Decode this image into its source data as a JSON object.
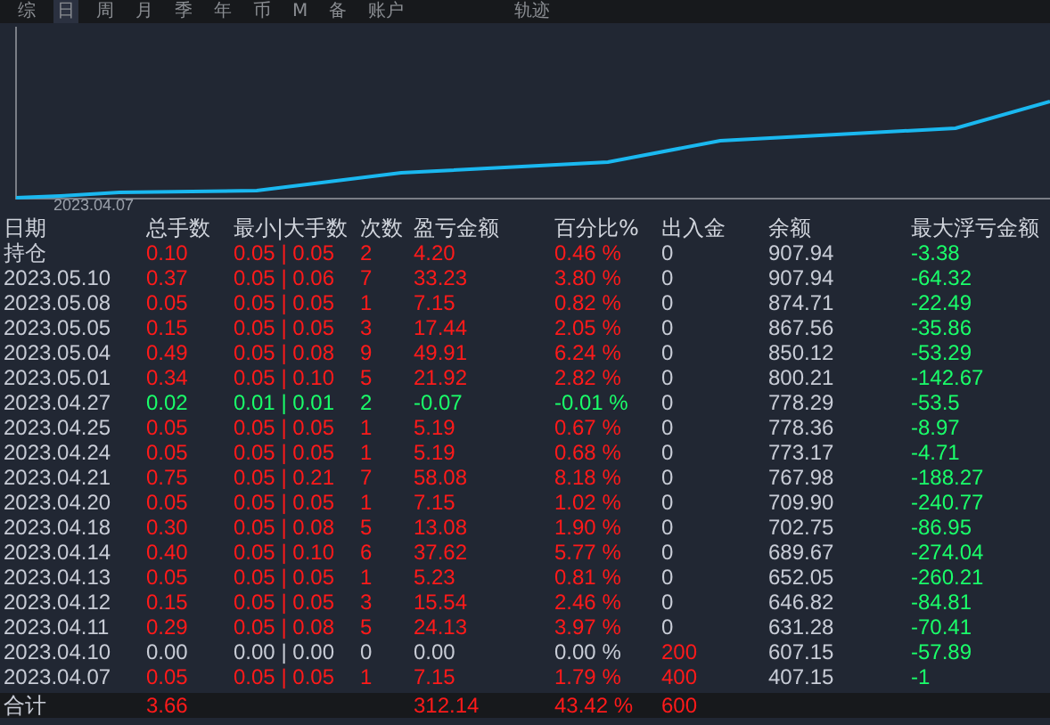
{
  "tabs": [
    {
      "label": "综",
      "selected": false
    },
    {
      "label": "日",
      "selected": true
    },
    {
      "label": "周",
      "selected": false
    },
    {
      "label": "月",
      "selected": false
    },
    {
      "label": "季",
      "selected": false
    },
    {
      "label": "年",
      "selected": false
    },
    {
      "label": "币",
      "selected": false
    },
    {
      "label": "M",
      "selected": false
    },
    {
      "label": "备",
      "selected": false
    },
    {
      "label": "账户",
      "selected": false
    },
    {
      "label": "轨迹",
      "selected": false
    }
  ],
  "chart": {
    "start_label": "2023.04.07"
  },
  "table": {
    "columns": [
      "日期",
      "总手数",
      "最小|大手数",
      "次数",
      "盈亏金额",
      "百分比%",
      "出入金",
      "余额",
      "最大浮亏金额"
    ],
    "rows": [
      {
        "date": "持仓",
        "lots": "0.10",
        "minmax": "0.05 | 0.05",
        "count": "2",
        "pnl": "4.20",
        "pct": "0.46 %",
        "flow": "0",
        "balance": "907.94",
        "max_float": "-3.38",
        "kind": "profit",
        "deposit": false
      },
      {
        "date": "2023.05.10",
        "lots": "0.37",
        "minmax": "0.05 | 0.06",
        "count": "7",
        "pnl": "33.23",
        "pct": "3.80 %",
        "flow": "0",
        "balance": "907.94",
        "max_float": "-64.32",
        "kind": "profit",
        "deposit": false
      },
      {
        "date": "2023.05.08",
        "lots": "0.05",
        "minmax": "0.05 | 0.05",
        "count": "1",
        "pnl": "7.15",
        "pct": "0.82 %",
        "flow": "0",
        "balance": "874.71",
        "max_float": "-22.49",
        "kind": "profit",
        "deposit": false
      },
      {
        "date": "2023.05.05",
        "lots": "0.15",
        "minmax": "0.05 | 0.05",
        "count": "3",
        "pnl": "17.44",
        "pct": "2.05 %",
        "flow": "0",
        "balance": "867.56",
        "max_float": "-35.86",
        "kind": "profit",
        "deposit": false
      },
      {
        "date": "2023.05.04",
        "lots": "0.49",
        "minmax": "0.05 | 0.08",
        "count": "9",
        "pnl": "49.91",
        "pct": "6.24 %",
        "flow": "0",
        "balance": "850.12",
        "max_float": "-53.29",
        "kind": "profit",
        "deposit": false
      },
      {
        "date": "2023.05.01",
        "lots": "0.34",
        "minmax": "0.05 | 0.10",
        "count": "5",
        "pnl": "21.92",
        "pct": "2.82 %",
        "flow": "0",
        "balance": "800.21",
        "max_float": "-142.67",
        "kind": "profit",
        "deposit": false
      },
      {
        "date": "2023.04.27",
        "lots": "0.02",
        "minmax": "0.01 | 0.01",
        "count": "2",
        "pnl": "-0.07",
        "pct": "-0.01 %",
        "flow": "0",
        "balance": "778.29",
        "max_float": "-53.5",
        "kind": "loss",
        "deposit": false
      },
      {
        "date": "2023.04.25",
        "lots": "0.05",
        "minmax": "0.05 | 0.05",
        "count": "1",
        "pnl": "5.19",
        "pct": "0.67 %",
        "flow": "0",
        "balance": "778.36",
        "max_float": "-8.97",
        "kind": "profit",
        "deposit": false
      },
      {
        "date": "2023.04.24",
        "lots": "0.05",
        "minmax": "0.05 | 0.05",
        "count": "1",
        "pnl": "5.19",
        "pct": "0.68 %",
        "flow": "0",
        "balance": "773.17",
        "max_float": "-4.71",
        "kind": "profit",
        "deposit": false
      },
      {
        "date": "2023.04.21",
        "lots": "0.75",
        "minmax": "0.05 | 0.21",
        "count": "7",
        "pnl": "58.08",
        "pct": "8.18 %",
        "flow": "0",
        "balance": "767.98",
        "max_float": "-188.27",
        "kind": "profit",
        "deposit": false
      },
      {
        "date": "2023.04.20",
        "lots": "0.05",
        "minmax": "0.05 | 0.05",
        "count": "1",
        "pnl": "7.15",
        "pct": "1.02 %",
        "flow": "0",
        "balance": "709.90",
        "max_float": "-240.77",
        "kind": "profit",
        "deposit": false
      },
      {
        "date": "2023.04.18",
        "lots": "0.30",
        "minmax": "0.05 | 0.08",
        "count": "5",
        "pnl": "13.08",
        "pct": "1.90 %",
        "flow": "0",
        "balance": "702.75",
        "max_float": "-86.95",
        "kind": "profit",
        "deposit": false
      },
      {
        "date": "2023.04.14",
        "lots": "0.40",
        "minmax": "0.05 | 0.10",
        "count": "6",
        "pnl": "37.62",
        "pct": "5.77 %",
        "flow": "0",
        "balance": "689.67",
        "max_float": "-274.04",
        "kind": "profit",
        "deposit": false
      },
      {
        "date": "2023.04.13",
        "lots": "0.05",
        "minmax": "0.05 | 0.05",
        "count": "1",
        "pnl": "5.23",
        "pct": "0.81 %",
        "flow": "0",
        "balance": "652.05",
        "max_float": "-260.21",
        "kind": "profit",
        "deposit": false
      },
      {
        "date": "2023.04.12",
        "lots": "0.15",
        "minmax": "0.05 | 0.05",
        "count": "3",
        "pnl": "15.54",
        "pct": "2.46 %",
        "flow": "0",
        "balance": "646.82",
        "max_float": "-84.81",
        "kind": "profit",
        "deposit": false
      },
      {
        "date": "2023.04.11",
        "lots": "0.29",
        "minmax": "0.05 | 0.08",
        "count": "5",
        "pnl": "24.13",
        "pct": "3.97 %",
        "flow": "0",
        "balance": "631.28",
        "max_float": "-70.41",
        "kind": "profit",
        "deposit": false
      },
      {
        "date": "2023.04.10",
        "lots": "0.00",
        "minmax": "0.00 | 0.00",
        "count": "0",
        "pnl": "0.00",
        "pct": "0.00 %",
        "flow": "200",
        "balance": "607.15",
        "max_float": "-57.89",
        "kind": "flat",
        "deposit": true
      },
      {
        "date": "2023.04.07",
        "lots": "0.05",
        "minmax": "0.05 | 0.05",
        "count": "1",
        "pnl": "7.15",
        "pct": "1.79 %",
        "flow": "400",
        "balance": "407.15",
        "max_float": "-1",
        "kind": "profit",
        "deposit": true
      }
    ],
    "total": {
      "date": "合计",
      "lots": "3.66",
      "pnl": "312.14",
      "pct": "43.42 %",
      "flow": "600"
    }
  }
}
